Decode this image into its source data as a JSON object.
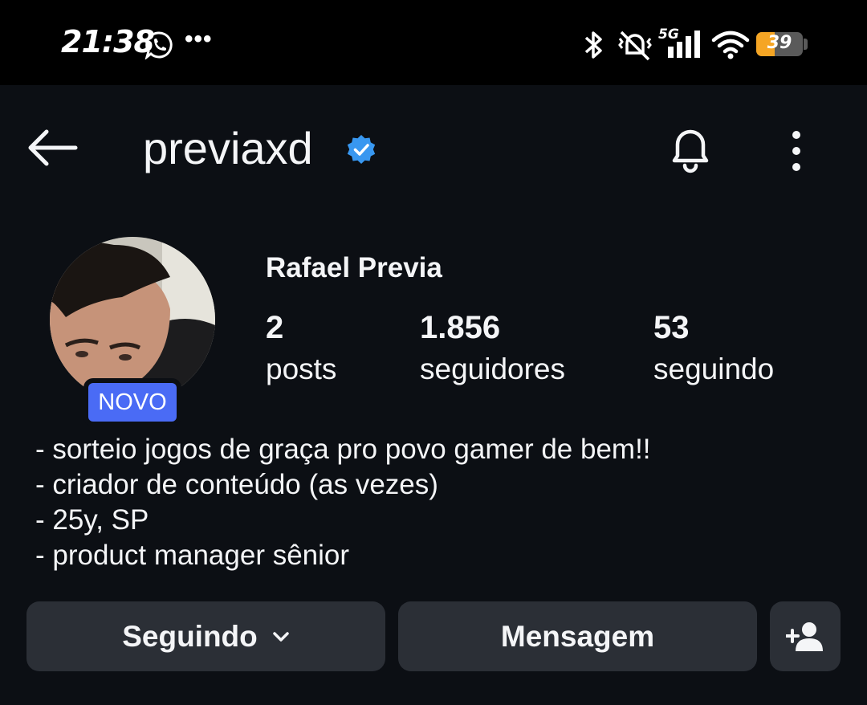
{
  "status_bar": {
    "time": "21:38",
    "overflow_dots": "•••",
    "battery_level": "39",
    "icons": [
      "whatsapp-icon",
      "bluetooth-icon",
      "vibrate-off-icon",
      "5g-signal-icon",
      "wifi-icon",
      "battery-icon"
    ]
  },
  "header": {
    "username": "previaxd",
    "verified": true,
    "icons": [
      "back-arrow-icon",
      "verified-badge-icon",
      "bell-icon",
      "more-vertical-icon"
    ]
  },
  "profile": {
    "badge": "NOVO",
    "full_name": "Rafael Previa",
    "stats": [
      {
        "value": "2",
        "label": "posts"
      },
      {
        "value": "1.856",
        "label": "seguidores"
      },
      {
        "value": "53",
        "label": "seguindo"
      }
    ],
    "bio": [
      "- sorteio jogos de graça pro povo gamer de bem!!",
      "- criador de conteúdo (as vezes)",
      "- 25y, SP",
      "- product manager sênior"
    ]
  },
  "actions": {
    "following_label": "Seguindo",
    "message_label": "Mensagem",
    "icons": [
      "chevron-down-icon",
      "add-person-icon"
    ]
  },
  "colors": {
    "background": "#0c0f14",
    "button": "#2b2f36",
    "badge": "#4a6bf5",
    "verified": "#3897f0",
    "battery": "#f5a524"
  }
}
